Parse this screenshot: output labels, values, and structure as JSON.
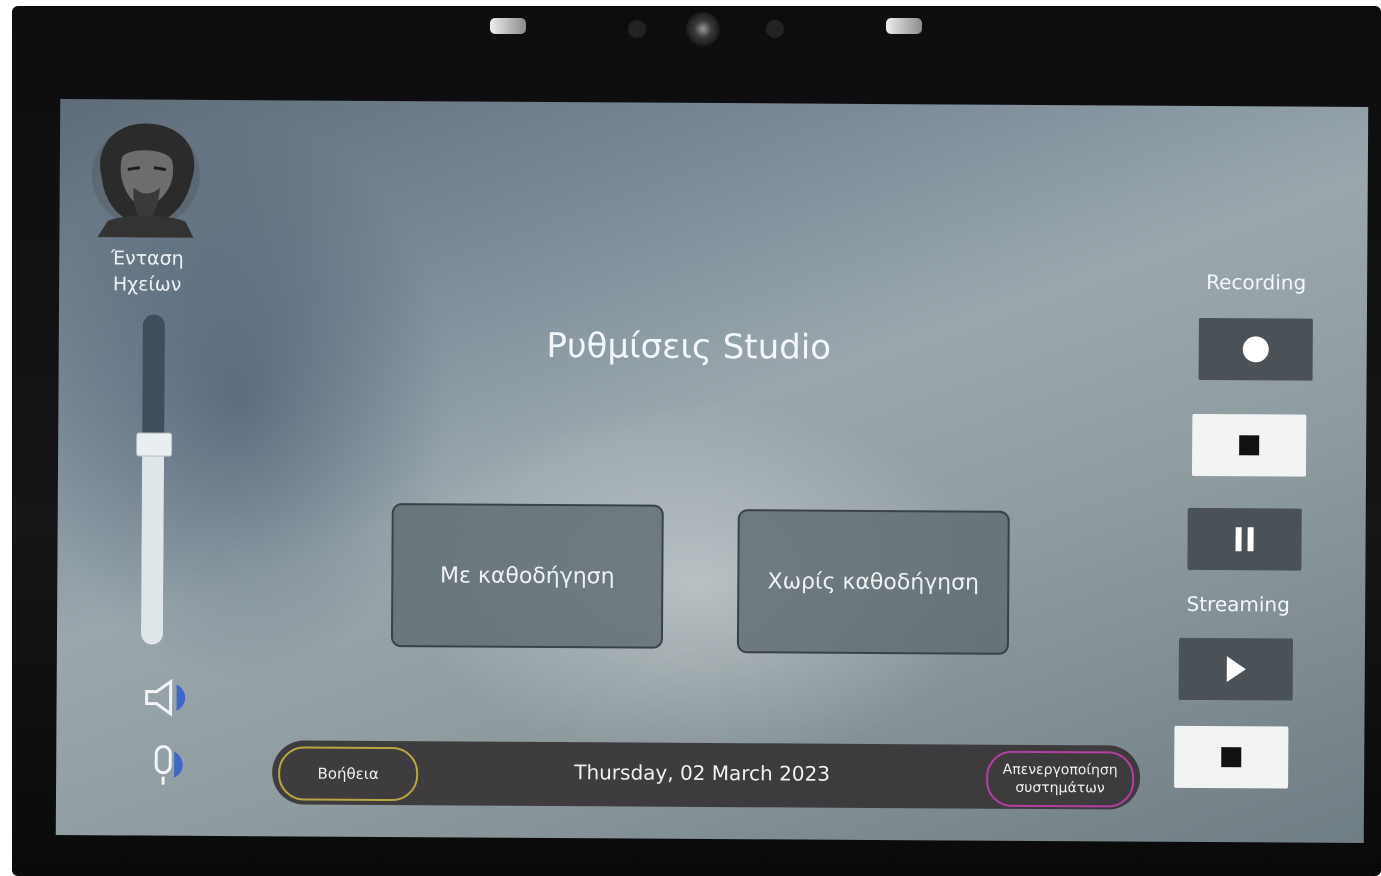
{
  "sidebar": {
    "logo_icon": "philosopher-bust-logo",
    "volume_label_line1": "Ένταση",
    "volume_label_line2": "Ηχείων",
    "volume_level": 0.61,
    "speaker_icon": "speaker-icon",
    "mic_icon": "microphone-icon"
  },
  "main": {
    "title": "Ρυθμίσεις Studio",
    "guided_button": "Με καθοδήγηση",
    "unguided_button": "Χωρίς καθοδήγηση"
  },
  "controls": {
    "recording_label": "Recording",
    "streaming_label": "Streaming"
  },
  "footer": {
    "help_button": "Βοήθεια",
    "date": "Thursday, 02 March 2023",
    "deactivate_line1": "Απενεργοποίηση",
    "deactivate_line2": "συστημάτων"
  },
  "colors": {
    "help_border": "#b9a642",
    "deactivate_border": "#b33fa0"
  }
}
